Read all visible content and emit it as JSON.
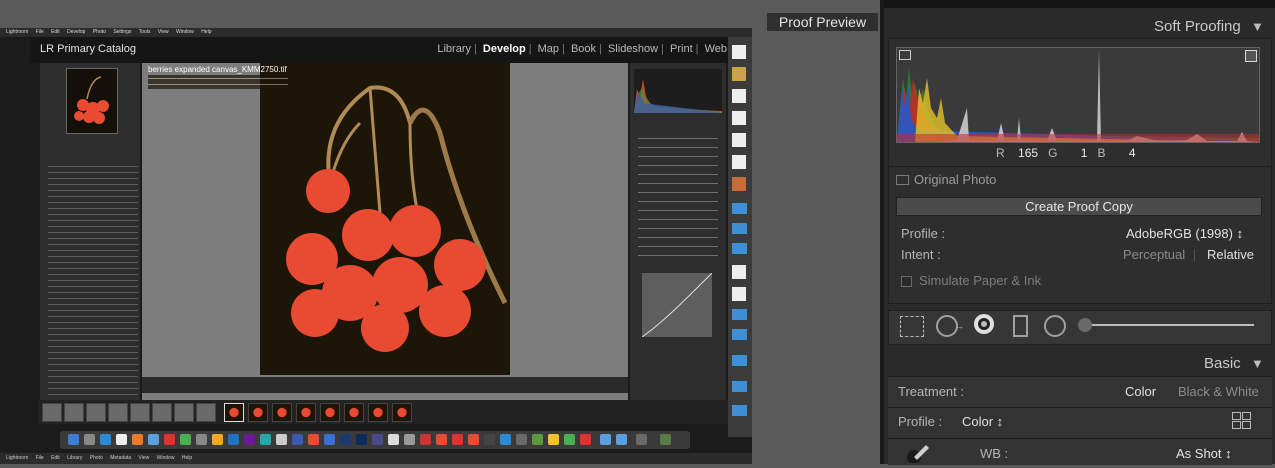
{
  "embedded": {
    "menubar_top": [
      "Lightroom",
      "File",
      "Edit",
      "Develop",
      "Photo",
      "Settings",
      "Tools",
      "View",
      "Window",
      "Help"
    ],
    "menubar_bottom": [
      "Lightroom",
      "File",
      "Edit",
      "Library",
      "Photo",
      "Metadata",
      "View",
      "Window",
      "Help"
    ],
    "catalog_title": "LR Primary Catalog",
    "modules": [
      "Library",
      "Develop",
      "Map",
      "Book",
      "Slideshow",
      "Print",
      "Web"
    ],
    "active_module": "Develop",
    "photo_title": "berries expanded canvas_KMM2750.tif",
    "colors": {
      "berry": "#e84a32",
      "photo_bg": "#1e1509",
      "stem": "#b08b55"
    }
  },
  "proof_preview": {
    "label": "Proof Preview"
  },
  "soft_proofing": {
    "title": "Soft Proofing",
    "readout": {
      "r_label": "R",
      "r": "165",
      "g_label": "G",
      "g": "1",
      "b_label": "B",
      "b": "4"
    },
    "original_photo": "Original Photo",
    "create_button": "Create Proof Copy",
    "profile_label": "Profile :",
    "profile_value": "AdobeRGB (1998) ↕",
    "intent_label": "Intent :",
    "intent_options": [
      "Perceptual",
      "Relative"
    ],
    "intent_selected": "Relative",
    "simulate_label": "Simulate Paper & Ink"
  },
  "basic": {
    "title": "Basic",
    "treatment_label": "Treatment :",
    "treatment_options": [
      "Color",
      "Black & White"
    ],
    "treatment_selected": "Color",
    "profile_label": "Profile :",
    "profile_value": "Color ↕",
    "wb_label": "WB :",
    "wb_value": "As Shot ↕"
  }
}
